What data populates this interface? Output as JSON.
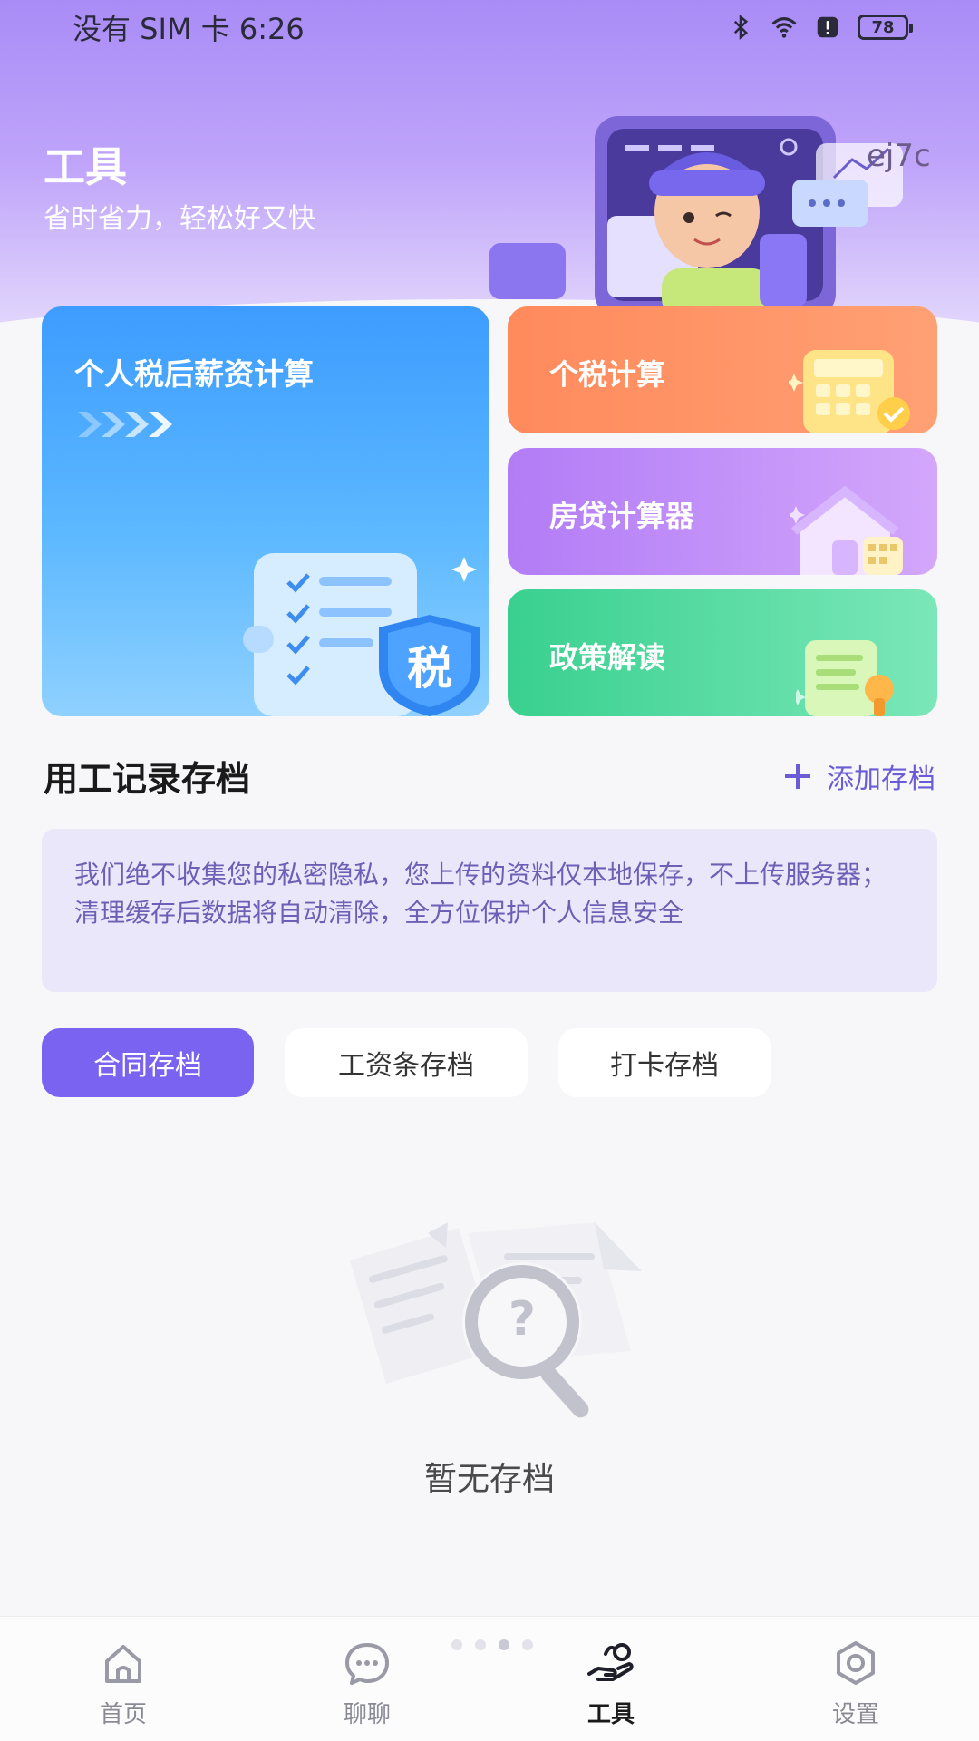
{
  "status_bar": {
    "carrier_time": "没有 SIM 卡 6:26",
    "battery": "78",
    "icons": [
      "bluetooth-icon",
      "wifi-icon",
      "alert-icon",
      "battery-icon"
    ]
  },
  "header": {
    "title": "工具",
    "subtitle": "省时省力，轻松好又快",
    "watermark": "ej7c"
  },
  "tools": {
    "salary": {
      "label": "个人税后薪资计算",
      "badge": "税"
    },
    "tax": {
      "label": "个税计算"
    },
    "mortgage": {
      "label": "房贷计算器"
    },
    "policy": {
      "label": "政策解读"
    }
  },
  "section": {
    "title": "用工记录存档",
    "add_label": "添加存档",
    "notice": "我们绝不收集您的私密隐私，您上传的资料仅本地保存，不上传服务器；清理缓存后数据将自动清除，全方位保护个人信息安全"
  },
  "tabs": [
    {
      "label": "合同存档",
      "active": true
    },
    {
      "label": "工资条存档",
      "active": false
    },
    {
      "label": "打卡存档",
      "active": false
    }
  ],
  "empty": {
    "text": "暂无存档"
  },
  "nav": [
    {
      "label": "首页",
      "icon": "home-icon",
      "active": false
    },
    {
      "label": "聊聊",
      "icon": "chat-icon",
      "active": false
    },
    {
      "label": "工具",
      "icon": "tools-icon",
      "active": true
    },
    {
      "label": "设置",
      "icon": "settings-icon",
      "active": false
    }
  ],
  "colors": {
    "accent": "#7b63f2",
    "hero_top": "#a98cf6",
    "tax_card": "#ff8a5c",
    "loan_card": "#b27cf6",
    "policy_card": "#39d08f",
    "salary_card": "#3d9cff"
  }
}
